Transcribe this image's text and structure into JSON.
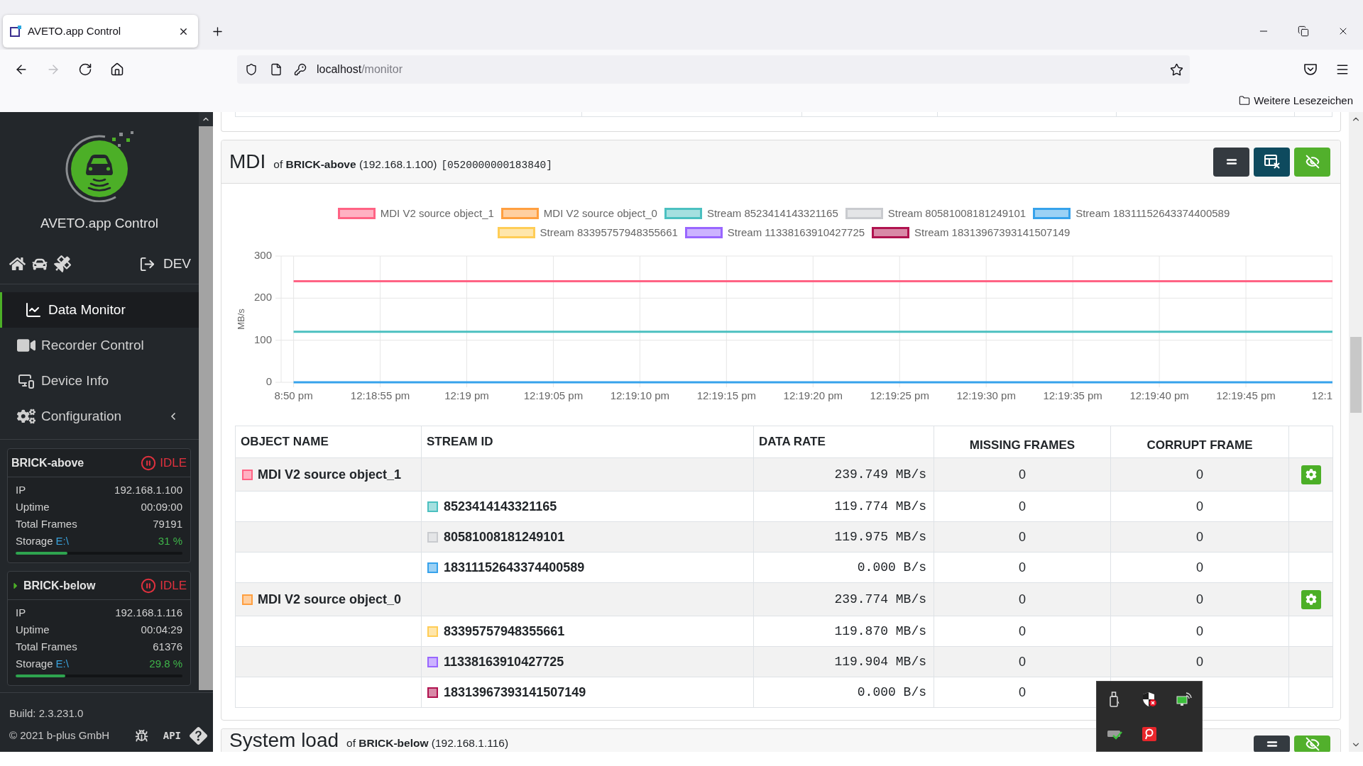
{
  "browser": {
    "tabs": [
      {
        "title": "AVETO.app Control",
        "selected": true
      }
    ],
    "nav_buttons": [
      {
        "disabled": false
      },
      {
        "disabled": true
      },
      {
        "disabled": false
      },
      {
        "disabled": false
      }
    ],
    "url": {
      "host": "localhost",
      "path": "/monitor"
    },
    "bookmarks": [
      {
        "label": "Weitere Lesezeichen"
      }
    ]
  },
  "sidebar": {
    "app_name": "AVETO.app Control",
    "mode": "DEV",
    "nav": [
      {
        "label": "Data Monitor",
        "selected": true
      },
      {
        "label": "Recorder Control",
        "selected": false
      },
      {
        "label": "Device Info",
        "selected": false
      },
      {
        "label": "Configuration",
        "selected": false,
        "submenu": {
          "expanded": false
        }
      }
    ],
    "devices": [
      {
        "name": "BRICK-above",
        "expander": false,
        "status": "IDLE",
        "fields": [
          {
            "label": "IP",
            "value": "192.168.1.100"
          },
          {
            "label": "Uptime",
            "value": "00:09:00"
          },
          {
            "label": "Total Frames",
            "value": "79191"
          }
        ],
        "storage": {
          "label": "Storage",
          "drive": "E:\\",
          "reading": "31 %",
          "level": 0.31
        }
      },
      {
        "name": "BRICK-below",
        "expander": true,
        "status": "IDLE",
        "fields": [
          {
            "label": "IP",
            "value": "192.168.1.116"
          },
          {
            "label": "Uptime",
            "value": "00:04:29"
          },
          {
            "label": "Total Frames",
            "value": "61376"
          }
        ],
        "storage": {
          "label": "Storage",
          "drive": "E:\\",
          "reading": "29.8 %",
          "level": 0.298
        }
      }
    ],
    "footer": {
      "build": "Build: 2.3.231.0",
      "copyright": "© 2021 b-plus GmbH",
      "api": "API"
    }
  },
  "panels": [
    {
      "title": "MDI",
      "subtitle": "of **BRICK-above** (192.168.1.100)",
      "serial": "[0520000000183840]",
      "buttons": [
        {
          "kind": "collapse"
        },
        {
          "kind": "table"
        },
        {
          "kind": "hide"
        }
      ],
      "chart_data": {
        "type": "line",
        "ylabel": "MB/s",
        "x": [
          "8:50 pm",
          "12:18:55 pm",
          "12:19 pm",
          "12:19:05 pm",
          "12:19:10 pm",
          "12:19:15 pm",
          "12:19:20 pm",
          "12:19:25 pm",
          "12:19:30 pm",
          "12:19:35 pm",
          "12:19:40 pm",
          "12:19:45 pm",
          "12:1"
        ],
        "ylim": [
          0,
          300
        ],
        "yticks": [
          0,
          100,
          200,
          300
        ],
        "grid": true,
        "legend": "top",
        "series": [
          {
            "name": "MDI V2 source object_1",
            "color": "#ff6384",
            "values": [
              240,
              240,
              240,
              240,
              240,
              240,
              240,
              240,
              240,
              240,
              240,
              240,
              240
            ]
          },
          {
            "name": "MDI V2 source object_0",
            "color": "#ff9f40",
            "values": [
              null,
              null,
              null,
              null,
              null,
              null,
              null,
              null,
              null,
              null,
              null,
              null,
              null
            ]
          },
          {
            "name": "Stream 8523414143321165",
            "color": "#4bc0c0",
            "values": [
              120,
              120,
              120,
              120,
              120,
              120,
              120,
              120,
              120,
              120,
              120,
              120,
              120
            ]
          },
          {
            "name": "Stream 80581008181249101",
            "color": "#c9cbcf",
            "values": [
              null,
              null,
              null,
              null,
              null,
              null,
              null,
              null,
              null,
              null,
              null,
              null,
              null
            ]
          },
          {
            "name": "Stream 18311152643374400589",
            "color": "#36a2eb",
            "values": [
              0,
              0,
              0,
              0,
              0,
              0,
              0,
              0,
              0,
              0,
              0,
              0,
              0
            ]
          },
          {
            "name": "Stream 83395757948355661",
            "color": "#ffcd56",
            "values": [
              null,
              null,
              null,
              null,
              null,
              null,
              null,
              null,
              null,
              null,
              null,
              null,
              null
            ]
          },
          {
            "name": "Stream 11338163910427725",
            "color": "#9966ff",
            "values": [
              null,
              null,
              null,
              null,
              null,
              null,
              null,
              null,
              null,
              null,
              null,
              null,
              null
            ]
          },
          {
            "name": "Stream 18313967393141507149",
            "color": "#b0124f",
            "values": [
              null,
              null,
              null,
              null,
              null,
              null,
              null,
              null,
              null,
              null,
              null,
              null,
              null
            ]
          }
        ]
      },
      "table": {
        "columns": [
          "OBJECT NAME",
          "STREAM ID",
          "DATA RATE",
          "MISSING FRAMES",
          "CORRUPT FRAME"
        ],
        "rows": [
          {
            "name": "MDI V2 source object_1",
            "color": "#ff6384",
            "data_rate": "239.749 MB/s",
            "missing": "0",
            "corrupt": "0",
            "children": [
              {
                "stream_id": "8523414143321165",
                "color": "#4bc0c0",
                "data_rate": "119.774 MB/s",
                "missing": "0",
                "corrupt": "0"
              },
              {
                "stream_id": "80581008181249101",
                "color": "#c9cbcf",
                "data_rate": "119.975 MB/s",
                "missing": "0",
                "corrupt": "0"
              },
              {
                "stream_id": "18311152643374400589",
                "color": "#36a2eb",
                "data_rate": "0.000 B/s",
                "missing": "0",
                "corrupt": "0"
              }
            ]
          },
          {
            "name": "MDI V2 source object_0",
            "color": "#ff9f40",
            "data_rate": "239.774 MB/s",
            "missing": "0",
            "corrupt": "0",
            "children": [
              {
                "stream_id": "83395757948355661",
                "color": "#ffcd56",
                "data_rate": "119.870 MB/s",
                "missing": "0",
                "corrupt": "0"
              },
              {
                "stream_id": "11338163910427725",
                "color": "#9966ff",
                "data_rate": "119.904 MB/s",
                "missing": "0",
                "corrupt": "0"
              },
              {
                "stream_id": "18313967393141507149",
                "color": "#b0124f",
                "data_rate": "0.000 B/s",
                "missing": "0"
              }
            ]
          }
        ]
      }
    },
    {
      "title": "System load",
      "subtitle": "of **BRICK-below** (192.168.1.116)",
      "buttons": [
        {
          "kind": "collapse"
        },
        {
          "kind": "hide"
        }
      ]
    }
  ]
}
